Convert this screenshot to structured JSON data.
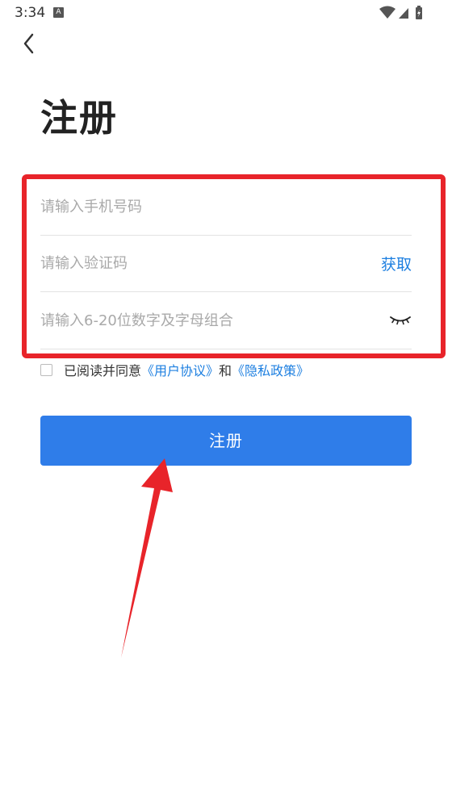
{
  "status_bar": {
    "time": "3:34",
    "notification_icon_letter": "A"
  },
  "page": {
    "title": "注册"
  },
  "form": {
    "phone_placeholder": "请输入手机号码",
    "code_placeholder": "请输入验证码",
    "get_code_label": "获取",
    "password_placeholder": "请输入6-20位数字及字母组合"
  },
  "agreement": {
    "prefix": "已阅读并同意",
    "user_agreement": "《用户协议》",
    "and": "和",
    "privacy_policy": "《隐私政策》",
    "checked": false
  },
  "register_button": {
    "label": "注册"
  },
  "colors": {
    "accent": "#2f7de9",
    "link": "#1d7fe0",
    "highlight": "#e8242a"
  }
}
